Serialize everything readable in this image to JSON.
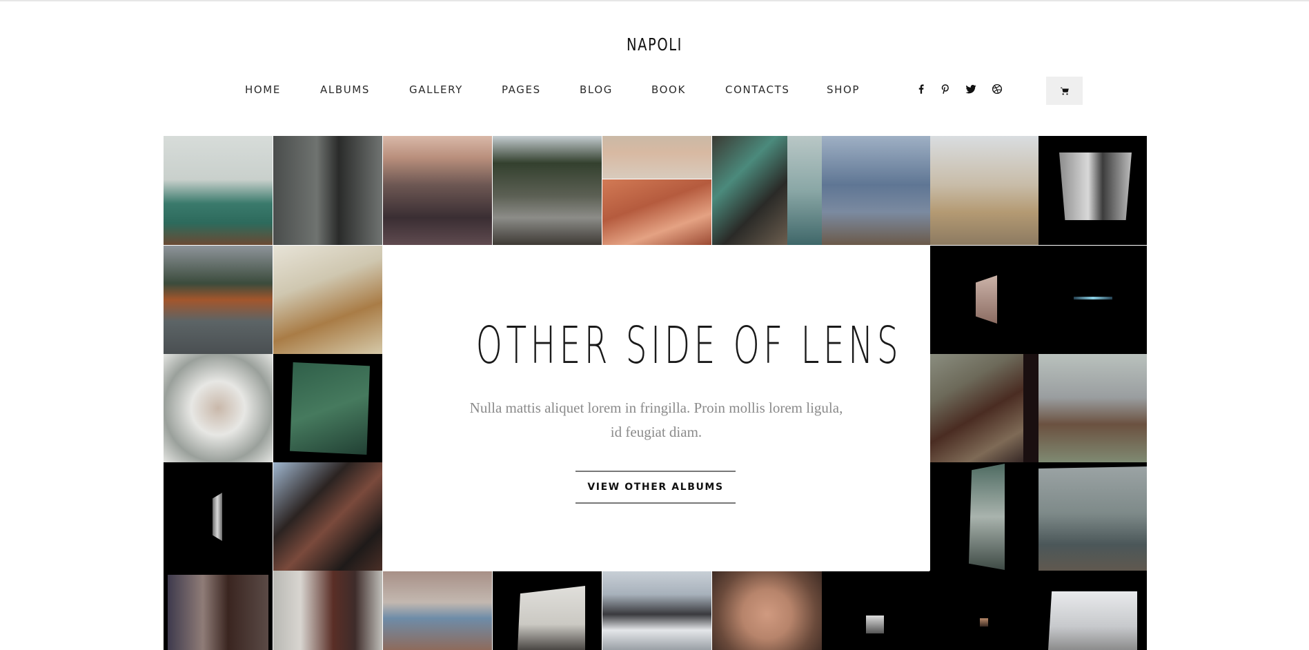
{
  "brand": {
    "logo": "NAPOLI"
  },
  "nav": {
    "items": [
      {
        "label": "HOME",
        "id": "home"
      },
      {
        "label": "ALBUMS",
        "id": "albums"
      },
      {
        "label": "GALLERY",
        "id": "gallery"
      },
      {
        "label": "PAGES",
        "id": "pages"
      },
      {
        "label": "BLOG",
        "id": "blog"
      },
      {
        "label": "BOOK",
        "id": "book"
      },
      {
        "label": "CONTACTS",
        "id": "contacts"
      },
      {
        "label": "SHOP",
        "id": "shop"
      }
    ]
  },
  "social": [
    {
      "icon": "facebook-icon"
    },
    {
      "icon": "pinterest-icon"
    },
    {
      "icon": "twitter-icon"
    },
    {
      "icon": "dribbble-icon"
    }
  ],
  "cart": {
    "icon": "cart-icon"
  },
  "hero": {
    "title": "OTHER SIDE OF LENS",
    "subtitle": "Nulla mattis aliquet lorem in fringilla. Proin mollis lorem ligula, id feugiat diam.",
    "button_label": "VIEW OTHER ALBUMS"
  },
  "gallery": {
    "tiles": [
      {
        "name": "photo-misty-sea",
        "bg": "linear-gradient(180deg,#d7dcd9 0%,#c9d0cc 40%,#3a7a6c 62%,#2d6a5c 80%,#6b4a34 100%)"
      },
      {
        "name": "photo-forest-girl",
        "bg": "linear-gradient(90deg,#4a4d4c 0%,#6f7370 40%,#2a2b2a 60%,#707472 100%)"
      },
      {
        "name": "photo-field-sunset",
        "bg": "linear-gradient(180deg,#d9b8a8 0%,#b98f7c 20%,#6d5753 45%,#3a2e33 75%,#5f4a4f 100%)"
      },
      {
        "name": "photo-couple-mountain",
        "bg": "linear-gradient(180deg,#c4ccd0 0%,#33402e 25%,#5c6054 55%,#8c8c88 75%,#3e3a35 100%)"
      },
      {
        "name": "photo-skin-closeup",
        "bg": "linear-gradient(180deg,#cab9a6 0%,#d8b9a2 40%,#d8cbbd 100%)"
      },
      {
        "name": "photo-red-rocks",
        "bg": "linear-gradient(160deg,#d27a55 0%,#b55b3e 40%,#e4a283 70%,#9b4a33 100%)"
      },
      {
        "name": "photo-green-bench",
        "bg": "linear-gradient(135deg,#3b3a33 0%,#4b8a7c 35%,#2a2a27 65%,#6c5e4f 100%)"
      },
      {
        "name": "photo-lake-fog",
        "bg": "linear-gradient(180deg,#b9c7c6 0%,#8aa7a6 50%,#3f6769 100%)"
      },
      {
        "name": "photo-beach-woman",
        "bg": "linear-gradient(180deg,#9fb0c4 0%,#5f7694 45%,#7b8aa0 70%,#6b5a4a 100%)"
      },
      {
        "name": "photo-friends-field",
        "bg": "linear-gradient(180deg,#d9dde0 0%,#c8bca8 45%,#b49a73 70%,#8c7a61 100%)"
      },
      {
        "name": "photo-dark-1",
        "bg": "#000000",
        "inner": {
          "bg": "linear-gradient(90deg,#8d8d8d,#d9d9d9 40%,#3c3c3c 60%,#bdbdbd)"
        }
      },
      {
        "name": "photo-lake-autumn",
        "bg": "linear-gradient(180deg,#8e949a 0%,#3b4b3c 35%,#a3562c 50%,#5c6466 70%,#4a4f52 100%)"
      },
      {
        "name": "photo-windswept-hair",
        "bg": "linear-gradient(160deg,#e7e3d7 0%,#cfc7b0 35%,#a97c46 65%,#d5c9a9 100%)"
      },
      {
        "name": "photo-dark-2",
        "bg": "#000000",
        "inner": {
          "bg": "linear-gradient(180deg,#cbb3a8,#8c6d63)"
        }
      },
      {
        "name": "photo-dark-3",
        "bg": "#000000",
        "inner": {
          "bg": "linear-gradient(90deg,#244050,#8dd3e8,#244050)"
        }
      },
      {
        "name": "photo-white-flowers",
        "bg": "radial-gradient(circle at 50% 50%,#c9b8aa 0%,#e7e7e4 35%,#9aa09b 70%,#e4e5e2 100%)"
      },
      {
        "name": "photo-dark-4",
        "bg": "#000000",
        "inner": {
          "bg": "linear-gradient(160deg,#2f5f49,#467a5e 50%,#213f33)"
        }
      },
      {
        "name": "photo-horse",
        "bg": "linear-gradient(150deg,#8a8d7f 0%,#6d6a5a 30%,#4a2c22 55%,#7e6a56 80%,#362826 100%)"
      },
      {
        "name": "photo-legs-moss",
        "bg": "linear-gradient(180deg,#b9c1bd 0%,#9a9ea0 40%,#6b5140 65%,#7f8a72 100%)"
      },
      {
        "name": "photo-dark-5",
        "bg": "#000000",
        "inner": {
          "bg": "linear-gradient(90deg,#6b6b6b,#d8d8d8,#6b6b6b)"
        }
      },
      {
        "name": "photo-reflection",
        "bg": "linear-gradient(135deg,#9fb6cf 0%,#2b2321 35%,#7a4a3c 55%,#1e1a19 80%,#4a2f27 100%)"
      },
      {
        "name": "photo-dark-6",
        "bg": "#000000",
        "inner": {
          "bg": "linear-gradient(180deg,#4e6b62,#a9b3ad 50%,#3e4a45)"
        }
      },
      {
        "name": "photo-foggy-lake",
        "bg": "#000000",
        "inner": {
          "bg": "linear-gradient(180deg,#9ba3a4 0%,#7e8a89 45%,#4b5759 75%,#60584f 100%)"
        }
      },
      {
        "name": "photo-portrait-shadow",
        "bg": "#000000",
        "inner": {
          "bg": "linear-gradient(90deg,#3e3a4d 0%,#8f7c77 35%,#3a2520 60%,#5a4a46 100%)"
        }
      },
      {
        "name": "photo-redhead",
        "bg": "linear-gradient(90deg,#b9b9b4 0%,#d8d5d0 25%,#5a2e26 55%,#3e2c2a 75%,#c0bfba 100%)"
      },
      {
        "name": "photo-blue-eye",
        "bg": "linear-gradient(180deg,#a78f86 0%,#c3b8b0 40%,#6e8ca8 60%,#8e6b5c 100%)"
      },
      {
        "name": "photo-dark-7",
        "bg": "#000000",
        "inner": {
          "bg": "linear-gradient(180deg,#e0dfdb,#cbc9c3 60%,#4a4744)"
        }
      },
      {
        "name": "photo-snow-mountain",
        "bg": "linear-gradient(180deg,#c9d0d7 0%,#a7b1bb 30%,#3a3a3e 55%,#e4e6e9 75%,#9aa0a6 100%)"
      },
      {
        "name": "photo-face-closeup",
        "bg": "radial-gradient(circle at 50% 55%,#d09a80 0%,#b7846b 35%,#6a4a3b 70%,#3c2a23 100%)"
      },
      {
        "name": "photo-dark-8",
        "bg": "#000000",
        "inner": {
          "bg": "linear-gradient(180deg,#ddd,#555)"
        }
      },
      {
        "name": "photo-dark-9",
        "bg": "#000000",
        "inner": {
          "bg": "linear-gradient(180deg,#b98a6a,#3a2a22)"
        }
      },
      {
        "name": "photo-dark-10",
        "bg": "#000000",
        "inner": {
          "bg": "linear-gradient(180deg,#e9eaec 0%,#c7c9cc 60%,#8c8c8c 100%)"
        }
      }
    ]
  }
}
